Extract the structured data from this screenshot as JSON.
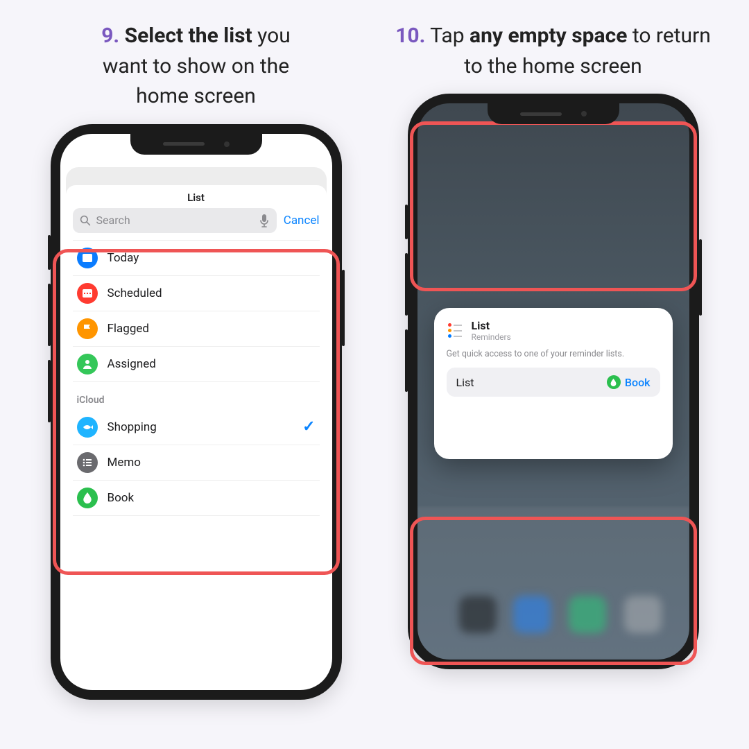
{
  "steps": {
    "nine": {
      "num": "9.",
      "bold": "Select the list",
      "rest1": " you",
      "line2": "want to show on the",
      "line3": "home screen"
    },
    "ten": {
      "num": "10.",
      "pre": " Tap ",
      "bold": "any empty space",
      "line2": " to return",
      "line3": "to the home screen"
    }
  },
  "sheet": {
    "title": "List",
    "search_placeholder": "Search",
    "cancel": "Cancel",
    "smart": [
      {
        "label": "Today",
        "color": "#0a7cff",
        "icon": "today"
      },
      {
        "label": "Scheduled",
        "color": "#ff3b30",
        "icon": "calendar"
      },
      {
        "label": "Flagged",
        "color": "#ff9500",
        "icon": "flag"
      },
      {
        "label": "Assigned",
        "color": "#34c759",
        "icon": "person"
      }
    ],
    "section": "iCloud",
    "custom": [
      {
        "label": "Shopping",
        "color": "#1fb4ff",
        "icon": "fish",
        "checked": true
      },
      {
        "label": "Memo",
        "color": "#6a6a6e",
        "icon": "lines"
      },
      {
        "label": "Book",
        "color": "#2bbf4e",
        "icon": "drop"
      }
    ]
  },
  "widget": {
    "title": "List",
    "app": "Reminders",
    "desc": "Get quick access to one of your reminder lists.",
    "row_label": "List",
    "row_value": "Book"
  }
}
